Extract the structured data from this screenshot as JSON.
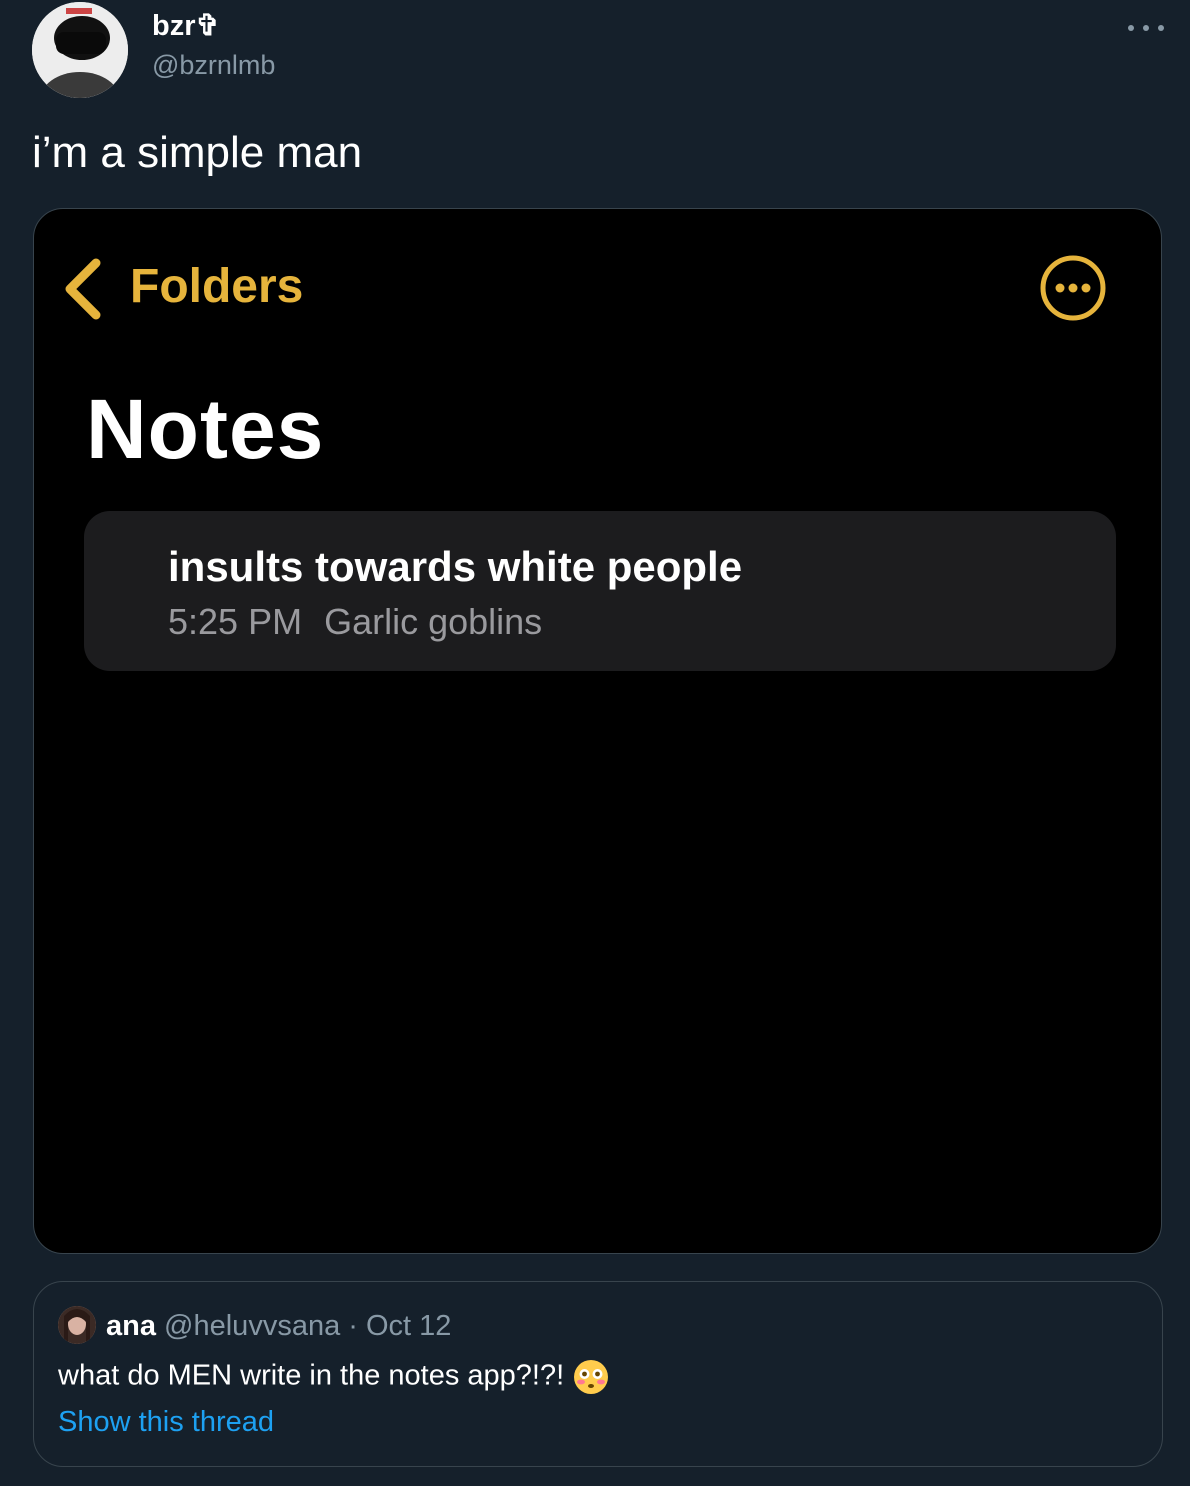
{
  "tweet": {
    "author_name": "bzr✞",
    "author_handle": "@bzrnlmb",
    "text": "i’m a simple man",
    "more_icon": "more-horizontal-icon"
  },
  "media": {
    "back_label": "Folders",
    "title": "Notes",
    "accent_color": "#e6b43c",
    "note": {
      "title": "insults towards white people",
      "time": "5:25 PM",
      "preview": "Garlic goblins"
    }
  },
  "quote": {
    "name": "ana",
    "handle": "@heluvvsana",
    "separator": "·",
    "date": "Oct 12",
    "text": "what do MEN write in the notes app?!?!",
    "emoji": "flushed-face",
    "show_thread": "Show this thread"
  },
  "colors": {
    "background": "#15202b",
    "link": "#1da1f2",
    "secondary_text": "#8899a6"
  }
}
